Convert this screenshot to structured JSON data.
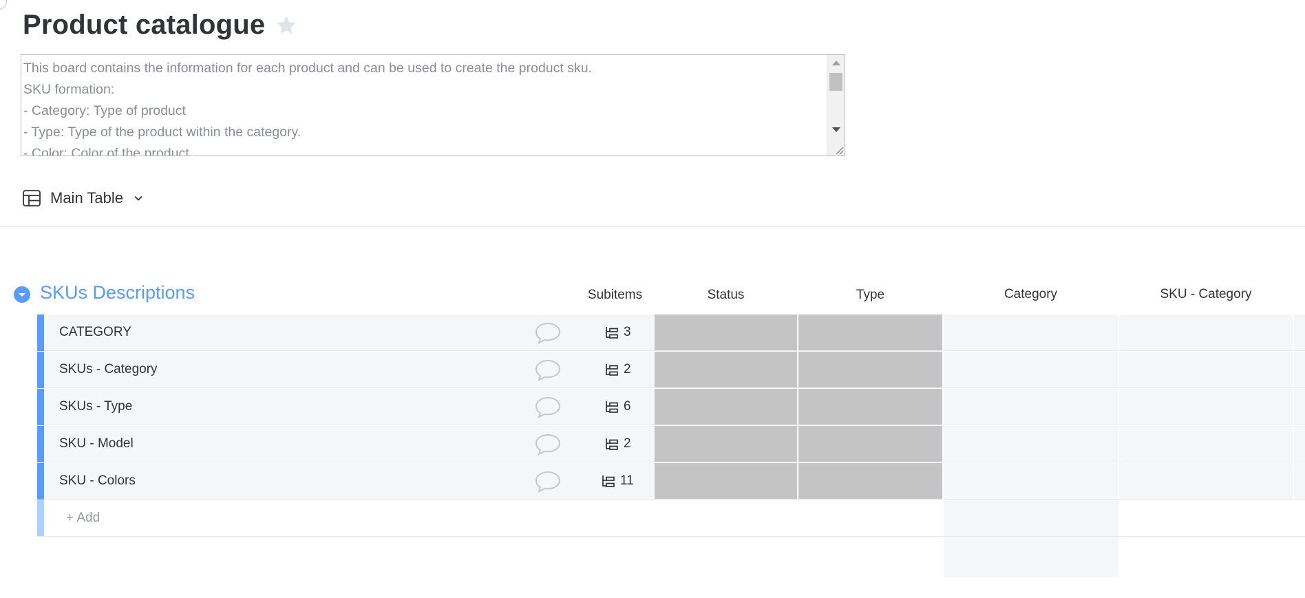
{
  "board": {
    "title": "Product catalogue",
    "favorite_icon": "star-icon",
    "description_lines": [
      "This board contains the information for each product and can be used to create the product sku.",
      "SKU formation:",
      "- Category: Type of product",
      "- Type: Type of the product within the category.",
      "- Color: Color of the product."
    ]
  },
  "view": {
    "label": "Main Table",
    "icon": "table-icon",
    "dropdown_icon": "chevron-down-icon"
  },
  "group": {
    "title": "SKUs Descriptions",
    "color": "#579bfc",
    "columns": {
      "subitems": "Subitems",
      "status": "Status",
      "type": "Type",
      "category": "Category",
      "sku_category": "SKU - Category"
    },
    "rows": [
      {
        "name": "CATEGORY",
        "subitems": "3"
      },
      {
        "name": "SKUs - Category",
        "subitems": "2"
      },
      {
        "name": "SKUs - Type",
        "subitems": "6"
      },
      {
        "name": "SKU - Model",
        "subitems": "2"
      },
      {
        "name": "SKU - Colors",
        "subitems": "11"
      }
    ],
    "add_label": "+ Add"
  },
  "colors": {
    "accent": "#579bfc",
    "empty_status": "#c4c4c4",
    "row_bg": "#f5f6f8"
  }
}
